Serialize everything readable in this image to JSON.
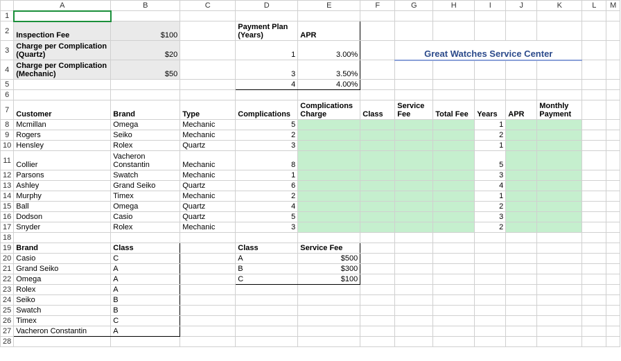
{
  "columns": [
    "A",
    "B",
    "C",
    "D",
    "E",
    "F",
    "G",
    "H",
    "I",
    "J",
    "K",
    "L",
    "M"
  ],
  "rows_shown": 28,
  "title": "Great Watches Service Center",
  "fees": {
    "inspection_label": "Inspection Fee",
    "inspection_value": "$100",
    "quartz_label": "Charge per Complication (Quartz)",
    "quartz_value": "$20",
    "mechanic_label": "Charge per Complication (Mechanic)",
    "mechanic_value": "$50"
  },
  "plan_header_years": "Payment Plan (Years)",
  "plan_header_apr": "APR",
  "plans": [
    {
      "years": "1",
      "apr": "3.00%"
    },
    {
      "years": "3",
      "apr": "3.50%"
    },
    {
      "years": "4",
      "apr": "4.00%"
    }
  ],
  "table_headers": {
    "customer": "Customer",
    "brand": "Brand",
    "type": "Type",
    "complications": "Complications",
    "complications_charge": "Complications Charge",
    "class": "Class",
    "service_fee": "Service Fee",
    "total_fee": "Total Fee",
    "years": "Years",
    "apr": "APR",
    "monthly_payment": "Monthly Payment"
  },
  "customers": [
    {
      "name": "Mcmillan",
      "brand": "Omega",
      "type": "Mechanic",
      "comp": "5",
      "years": "1"
    },
    {
      "name": "Rogers",
      "brand": "Seiko",
      "type": "Mechanic",
      "comp": "2",
      "years": "2"
    },
    {
      "name": "Hensley",
      "brand": "Rolex",
      "type": "Quartz",
      "comp": "3",
      "years": "1"
    },
    {
      "name": "Collier",
      "brand": "Vacheron Constantin",
      "type": "Mechanic",
      "comp": "8",
      "years": "5"
    },
    {
      "name": "Parsons",
      "brand": "Swatch",
      "type": "Mechanic",
      "comp": "1",
      "years": "3"
    },
    {
      "name": "Ashley",
      "brand": "Grand Seiko",
      "type": "Quartz",
      "comp": "6",
      "years": "4"
    },
    {
      "name": "Murphy",
      "brand": "Timex",
      "type": "Mechanic",
      "comp": "2",
      "years": "1"
    },
    {
      "name": "Ball",
      "brand": "Omega",
      "type": "Quartz",
      "comp": "4",
      "years": "2"
    },
    {
      "name": "Dodson",
      "brand": "Casio",
      "type": "Quartz",
      "comp": "5",
      "years": "3"
    },
    {
      "name": "Snyder",
      "brand": "Rolex",
      "type": "Mechanic",
      "comp": "3",
      "years": "2"
    }
  ],
  "brand_class_header": {
    "brand": "Brand",
    "class": "Class"
  },
  "brand_class": [
    {
      "brand": "Casio",
      "class": "C"
    },
    {
      "brand": "Grand Seiko",
      "class": "A"
    },
    {
      "brand": "Omega",
      "class": "A"
    },
    {
      "brand": "Rolex",
      "class": "A"
    },
    {
      "brand": "Seiko",
      "class": "B"
    },
    {
      "brand": "Swatch",
      "class": "B"
    },
    {
      "brand": "Timex",
      "class": "C"
    },
    {
      "brand": "Vacheron Constantin",
      "class": "A"
    }
  ],
  "class_fee_header": {
    "class": "Class",
    "fee": "Service Fee"
  },
  "class_fee": [
    {
      "class": "A",
      "fee": "$500"
    },
    {
      "class": "B",
      "fee": "$300"
    },
    {
      "class": "C",
      "fee": "$100"
    }
  ]
}
